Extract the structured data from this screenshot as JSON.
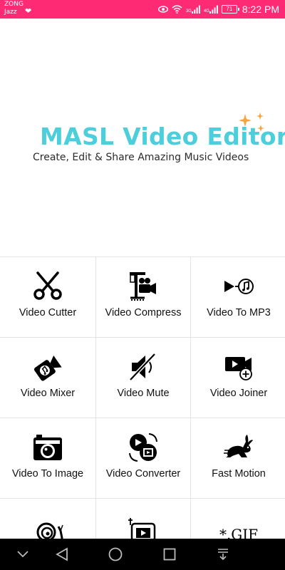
{
  "status_bar": {
    "carrier_line1": "ZONG",
    "carrier_line2": "Jazz",
    "network_1": "3G",
    "network_2": "4G",
    "battery": "71",
    "time": "8:22 PM",
    "background_color": "#ff2a74"
  },
  "banner": {
    "title": "MASL Video Editor",
    "subtitle": "Create, Edit & Share Amazing Music Videos",
    "title_color": "#4ccfdb",
    "sparkle_color": "#f5a442"
  },
  "tools": [
    {
      "label": "Video Cutter",
      "icon": "scissors-icon"
    },
    {
      "label": "Video Compress",
      "icon": "compress-clamp-icon"
    },
    {
      "label": "Video To MP3",
      "icon": "play-to-music-icon"
    },
    {
      "label": "Video Mixer",
      "icon": "camera-music-icon"
    },
    {
      "label": "Video Mute",
      "icon": "mute-speaker-icon"
    },
    {
      "label": "Video Joiner",
      "icon": "video-add-icon"
    },
    {
      "label": "Video To Image",
      "icon": "photo-camera-icon"
    },
    {
      "label": "Video Converter",
      "icon": "convert-film-icon"
    },
    {
      "label": "Fast Motion",
      "icon": "rabbit-icon"
    },
    {
      "label": "",
      "icon": "snail-icon"
    },
    {
      "label": "",
      "icon": "video-frame-icon"
    },
    {
      "label": "",
      "icon": "gif-icon",
      "icon_text": "*.GIF"
    }
  ],
  "nav": {
    "items": [
      "chevron-down-icon",
      "back-icon",
      "home-icon",
      "recents-icon",
      "notification-drawer-icon"
    ]
  }
}
